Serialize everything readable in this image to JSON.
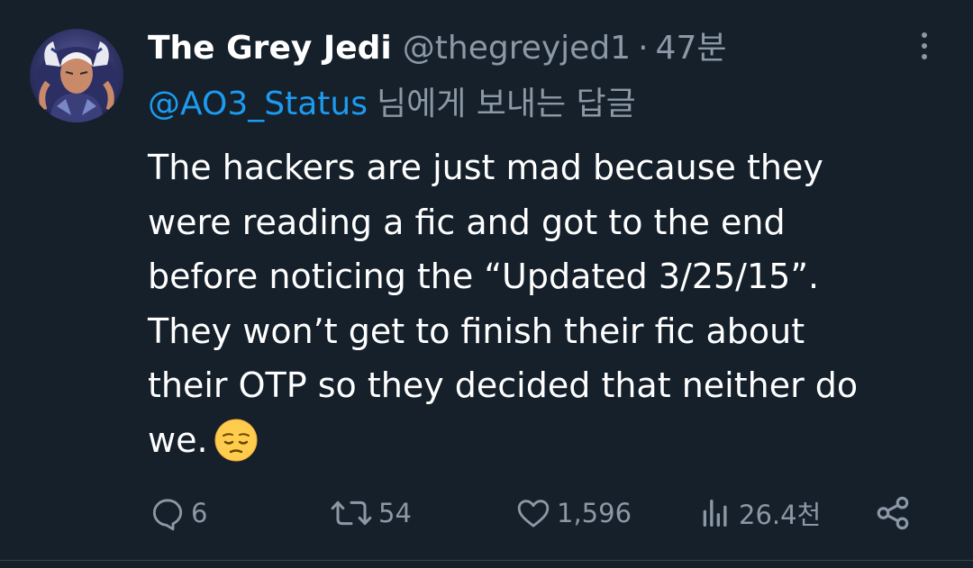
{
  "author": {
    "display_name": "The Grey Jedi",
    "handle": "@thegreyjed1",
    "separator": "·",
    "time": "47분"
  },
  "reply": {
    "mention": "@AO3_Status",
    "suffix": "님에게 보내는 답글"
  },
  "tweet": {
    "lines": [
      "The hackers are just mad because they",
      "were reading a fic and got to the end",
      "before noticing the “Updated 3/25/15”.",
      "They won’t get to finish their fic about",
      "their OTP so they decided that neither do",
      "we."
    ],
    "emoji": "pensive-face-emoji"
  },
  "actions": {
    "replies": "6",
    "retweets": "54",
    "likes": "1,596",
    "views": "26.4천"
  },
  "colors": {
    "background": "#15202b",
    "text_primary": "#ffffff",
    "text_secondary": "#8b98a5",
    "link": "#1d9bf0"
  },
  "icons": {
    "reply": "reply-icon",
    "retweet": "retweet-icon",
    "like": "heart-icon",
    "views": "views-icon",
    "share": "share-icon",
    "more": "more-icon"
  }
}
